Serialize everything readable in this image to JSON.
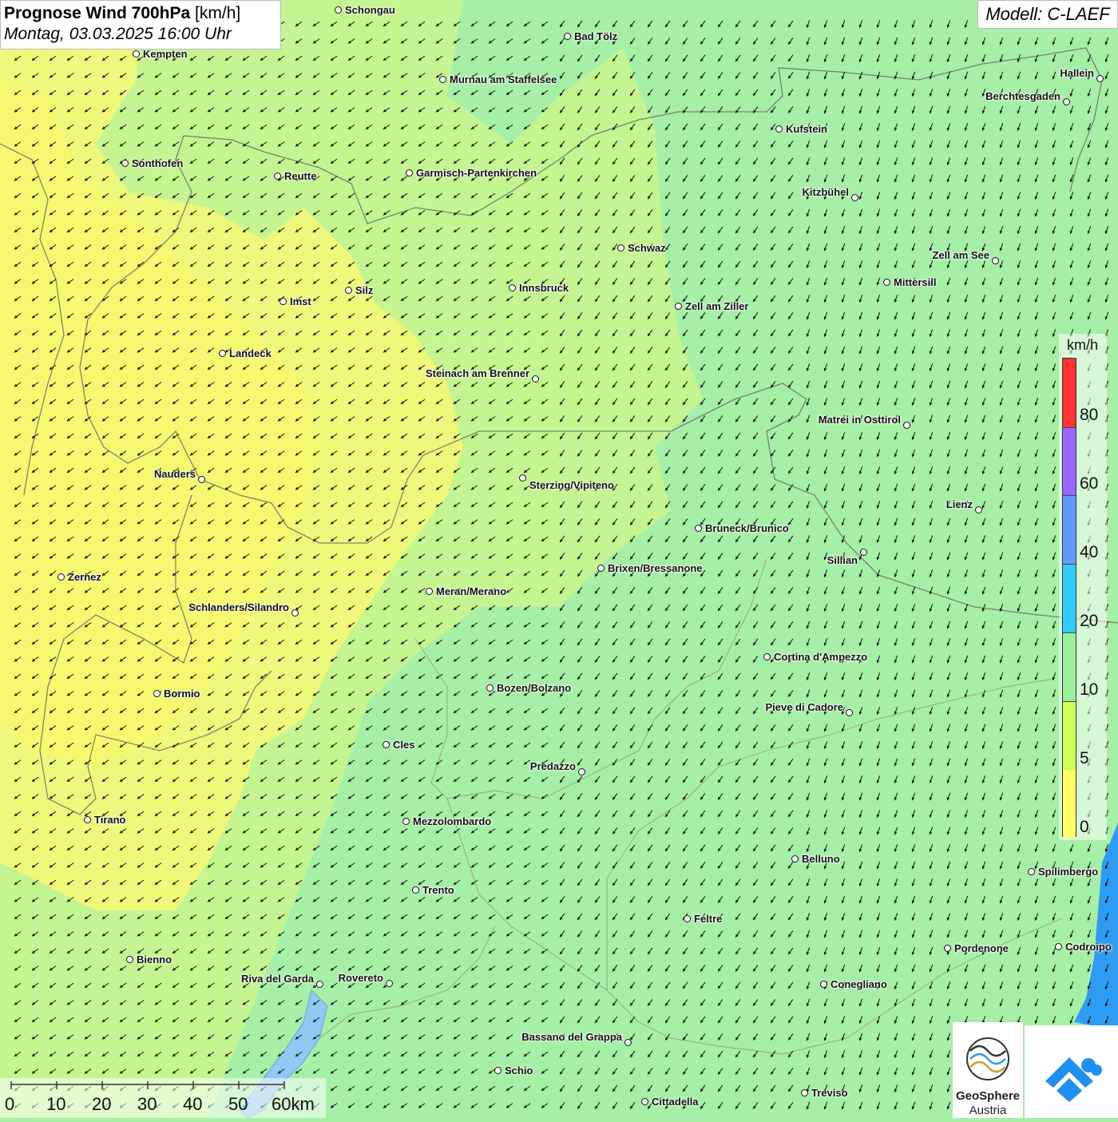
{
  "header": {
    "title_bold": "Prognose Wind 700hPa",
    "title_unit": "[km/h]",
    "datetime": "Montag, 03.03.2025 16:00 Uhr",
    "model": "Modell: C-LAEF"
  },
  "legend": {
    "unit": "km/h",
    "labels": [
      "0",
      "5",
      "10",
      "20",
      "40",
      "60",
      "80"
    ],
    "colors": [
      "#ffff66",
      "#ccff55",
      "#99f099",
      "#33ccff",
      "#6699ff",
      "#9966ff",
      "#ff3333"
    ]
  },
  "scalebar": {
    "labels": [
      "0",
      "10",
      "20",
      "30",
      "40",
      "50",
      "60km"
    ]
  },
  "logos": {
    "geosphere_line1": "GeoSphere",
    "geosphere_line2": "Austria"
  },
  "cities": [
    {
      "name": "Schongau"
    },
    {
      "name": "Bad Tölz"
    },
    {
      "name": "Kempten"
    },
    {
      "name": "Murnau am Staffelsee"
    },
    {
      "name": "Hallein"
    },
    {
      "name": "Berchtesgaden"
    },
    {
      "name": "Kufstein"
    },
    {
      "name": "Sonthofen"
    },
    {
      "name": "Reutte"
    },
    {
      "name": "Garmisch-Partenkirchen"
    },
    {
      "name": "Kitzbühel"
    },
    {
      "name": "Schwaz"
    },
    {
      "name": "Zell am See"
    },
    {
      "name": "Mittersill"
    },
    {
      "name": "Silz"
    },
    {
      "name": "Innsbruck"
    },
    {
      "name": "Imst"
    },
    {
      "name": "Zell am Ziller"
    },
    {
      "name": "Landeck"
    },
    {
      "name": "Steinach am Brenner"
    },
    {
      "name": "Matrei in Osttirol"
    },
    {
      "name": "Nauders"
    },
    {
      "name": "Sterzing/Vipiteno"
    },
    {
      "name": "Lienz"
    },
    {
      "name": "Bruneck/Brunico"
    },
    {
      "name": "Sillian"
    },
    {
      "name": "Zernez"
    },
    {
      "name": "Brixen/Bressanone"
    },
    {
      "name": "Meran/Merano"
    },
    {
      "name": "Schlanders/Silandro"
    },
    {
      "name": "Cortina d'Ampezzo"
    },
    {
      "name": "Bozen/Bolzano"
    },
    {
      "name": "Bormio"
    },
    {
      "name": "Pieve di Cadore"
    },
    {
      "name": "Cles"
    },
    {
      "name": "Predazzo"
    },
    {
      "name": "Tirano"
    },
    {
      "name": "Mezzolombardo"
    },
    {
      "name": "Belluno"
    },
    {
      "name": "Spilimbergo"
    },
    {
      "name": "Trento"
    },
    {
      "name": "Feltre"
    },
    {
      "name": "Bienno"
    },
    {
      "name": "Pordenone"
    },
    {
      "name": "Codroipo"
    },
    {
      "name": "Riva del Garda"
    },
    {
      "name": "Rovereto"
    },
    {
      "name": "Conegliano"
    },
    {
      "name": "Bassano del Grappa"
    },
    {
      "name": "Schio"
    },
    {
      "name": "Treviso"
    },
    {
      "name": "Cittadella"
    }
  ]
}
